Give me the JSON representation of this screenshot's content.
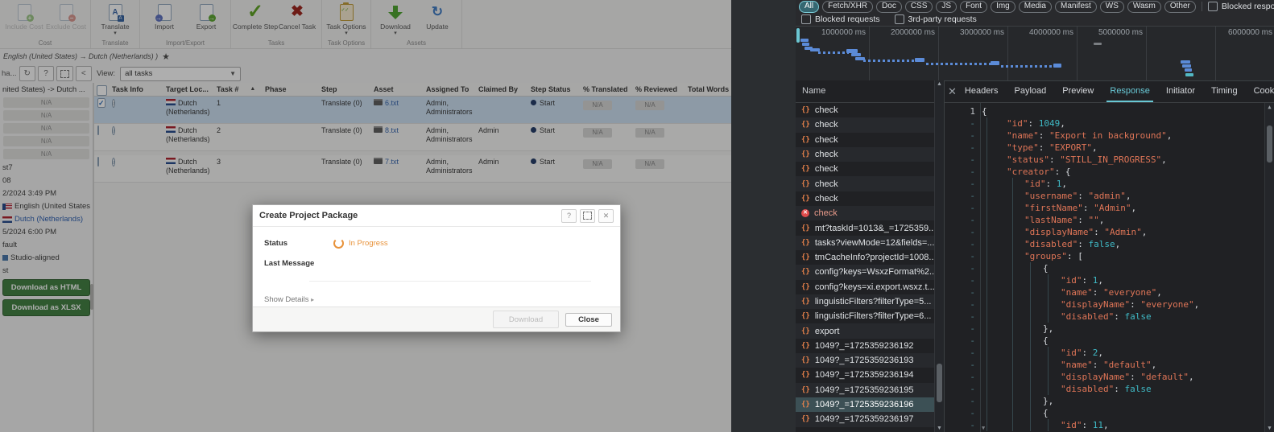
{
  "app": {
    "ribbon_groups": [
      {
        "label": "Cost",
        "buttons": [
          {
            "label": "Include Cost",
            "icon": "doc-plus",
            "disabled": true
          },
          {
            "label": "Exclude Cost",
            "icon": "doc-minus",
            "disabled": true
          }
        ]
      },
      {
        "label": "Translate",
        "buttons": [
          {
            "label": "Translate",
            "icon": "translate",
            "dropdown": true
          }
        ]
      },
      {
        "label": "Import/Export",
        "buttons": [
          {
            "label": "Import",
            "icon": "doc-import"
          },
          {
            "label": "Export",
            "icon": "doc-export"
          }
        ]
      },
      {
        "label": "Tasks",
        "buttons": [
          {
            "label": "Complete Step",
            "icon": "check"
          },
          {
            "label": "Cancel Task",
            "icon": "cross"
          }
        ]
      },
      {
        "label": "Task Options",
        "buttons": [
          {
            "label": "Task Options",
            "icon": "clipboard",
            "dropdown": true
          }
        ]
      },
      {
        "label": "Assets",
        "buttons": [
          {
            "label": "Download",
            "icon": "arrow-down",
            "dropdown": true
          },
          {
            "label": "Update",
            "icon": "refresh"
          }
        ]
      }
    ],
    "breadcrumb": "English (United States) → Dutch (Netherlands) )",
    "subheader": {
      "header_text": "ha...",
      "buttons": [
        "refresh",
        "help",
        "expand",
        "collapse"
      ]
    },
    "view": {
      "label": "View:",
      "value": "all tasks"
    },
    "sidebar": {
      "title": "nited States) -> Dutch ...",
      "na_rows": [
        "N/A",
        "N/A",
        "N/A",
        "N/A",
        "N/A"
      ],
      "lines": [
        {
          "text": "st7"
        },
        {
          "text": "08"
        },
        {
          "text": "2/2024 3:49 PM"
        },
        {
          "text": "English (United States)",
          "flag": "us"
        },
        {
          "text": "Dutch (Netherlands)",
          "flag": "nl",
          "link": true
        },
        {
          "text": "5/2024 6:00 PM"
        },
        {
          "text": "fault"
        },
        {
          "text": "Studio-aligned",
          "marker": true
        },
        {
          "text": "st"
        }
      ],
      "download_html": "Download as HTML",
      "download_xlsx": "Download as XLSX"
    },
    "table": {
      "headers": [
        "",
        "Task Info",
        "Target Loc...",
        "Task #",
        "Phase",
        "Step",
        "Asset",
        "Assigned To",
        "Claimed By",
        "Step Status",
        "% Translated",
        "% Reviewed",
        "Total Words"
      ],
      "sort_column": "Task #",
      "rows": [
        {
          "selected": true,
          "checked": true,
          "target1": "Dutch",
          "target2": "(Netherlands)",
          "task_no": "1",
          "phase": "",
          "step": "Translate (0)",
          "asset": "6.txt",
          "assigned1": "Admin,",
          "assigned2": "Administrators",
          "claimed": "",
          "status": "Start",
          "pct_translated": "N/A",
          "pct_reviewed": "N/A",
          "total_words": ""
        },
        {
          "selected": false,
          "checked": false,
          "target1": "Dutch",
          "target2": "(Netherlands)",
          "task_no": "2",
          "phase": "",
          "step": "Translate (0)",
          "asset": "8.txt",
          "assigned1": "Admin,",
          "assigned2": "Administrators",
          "claimed": "Admin",
          "status": "Start",
          "pct_translated": "N/A",
          "pct_reviewed": "N/A",
          "total_words": ""
        },
        {
          "selected": false,
          "checked": false,
          "target1": "Dutch",
          "target2": "(Netherlands)",
          "task_no": "3",
          "phase": "",
          "step": "Translate (0)",
          "asset": "7.txt",
          "assigned1": "Admin,",
          "assigned2": "Administrators",
          "claimed": "Admin",
          "status": "Start",
          "pct_translated": "N/A",
          "pct_reviewed": "N/A",
          "total_words": ""
        }
      ]
    },
    "modal": {
      "title": "Create Project Package",
      "help_label": "?",
      "close_x_label": "✕",
      "status_label": "Status",
      "status_value": "In Progress",
      "last_message_label": "Last Message",
      "show_details": "Show Details",
      "details_caret": "▸",
      "download_label": "Download",
      "close_label": "Close"
    }
  },
  "devtools": {
    "filters": {
      "pills": [
        "All",
        "Fetch/XHR",
        "Doc",
        "CSS",
        "JS",
        "Font",
        "Img",
        "Media",
        "Manifest",
        "WS",
        "Wasm",
        "Other"
      ],
      "active": "All",
      "blocked_response_cookies": "Blocked response cookies",
      "blocked_requests": "Blocked requests",
      "third_party_requests": "3rd-party requests"
    },
    "timeline": {
      "ticks": [
        "1000000 ms",
        "2000000 ms",
        "3000000 ms",
        "4000000 ms",
        "5000000 ms",
        "6000000 ms"
      ],
      "tick_x": [
        91,
        177,
        263,
        349,
        435,
        521
      ],
      "bars": [
        [
          6,
          15,
          10,
          4
        ],
        [
          8,
          20,
          9,
          4
        ],
        [
          11,
          25,
          10,
          4
        ],
        [
          18,
          27,
          12,
          4
        ],
        [
          63,
          28,
          14,
          5
        ],
        [
          69,
          33,
          12,
          4
        ],
        [
          74,
          38,
          12,
          4
        ],
        [
          148,
          39,
          12,
          5
        ],
        [
          242,
          43,
          11,
          5
        ],
        [
          320,
          46,
          10,
          5
        ],
        [
          478,
          42,
          12,
          4
        ],
        [
          480,
          47,
          11,
          4
        ],
        [
          483,
          52,
          9,
          4
        ]
      ],
      "dots": [
        [
          28,
          31,
          38
        ],
        [
          84,
          41,
          66
        ],
        [
          162,
          45,
          82
        ],
        [
          255,
          48,
          68
        ]
      ],
      "gray_dash": [
        370,
        20,
        10,
        3
      ],
      "teal_mark": [
        484,
        58,
        10,
        4
      ]
    },
    "name_header": "Name",
    "requests": [
      {
        "name": "check",
        "icon": "json"
      },
      {
        "name": "check",
        "icon": "json"
      },
      {
        "name": "check",
        "icon": "json"
      },
      {
        "name": "check",
        "icon": "json"
      },
      {
        "name": "check",
        "icon": "json"
      },
      {
        "name": "check",
        "icon": "json"
      },
      {
        "name": "check",
        "icon": "json"
      },
      {
        "name": "check",
        "icon": "error"
      },
      {
        "name": "mt?taskId=1013&_=1725359...",
        "icon": "json"
      },
      {
        "name": "tasks?viewMode=12&fields=...",
        "icon": "json"
      },
      {
        "name": "tmCacheInfo?projectId=1008...",
        "icon": "json"
      },
      {
        "name": "config?keys=WsxzFormat%2...",
        "icon": "json"
      },
      {
        "name": "config?keys=xi.export.wsxz.t...",
        "icon": "json"
      },
      {
        "name": "linguisticFilters?filterType=5...",
        "icon": "json"
      },
      {
        "name": "linguisticFilters?filterType=6...",
        "icon": "json"
      },
      {
        "name": "export",
        "icon": "json"
      },
      {
        "name": "1049?_=1725359236192",
        "icon": "json"
      },
      {
        "name": "1049?_=1725359236193",
        "icon": "json"
      },
      {
        "name": "1049?_=1725359236194",
        "icon": "json"
      },
      {
        "name": "1049?_=1725359236195",
        "icon": "json"
      },
      {
        "name": "1049?_=1725359236196",
        "icon": "json",
        "selected": true
      },
      {
        "name": "1049?_=1725359236197",
        "icon": "json"
      }
    ],
    "tabs": [
      "Headers",
      "Payload",
      "Preview",
      "Response",
      "Initiator",
      "Timing",
      "Cookies"
    ],
    "active_tab": "Response",
    "tab_close_label": "✕",
    "response_lines": [
      {
        "g": "1",
        "i": 0,
        "c": "{"
      },
      {
        "g": "-",
        "i": 1,
        "c": "\"id\": 1049,"
      },
      {
        "g": "-",
        "i": 1,
        "c": "\"name\": \"Export in background\","
      },
      {
        "g": "-",
        "i": 1,
        "c": "\"type\": \"EXPORT\","
      },
      {
        "g": "-",
        "i": 1,
        "c": "\"status\": \"STILL_IN_PROGRESS\","
      },
      {
        "g": "-",
        "i": 1,
        "c": "\"creator\": {"
      },
      {
        "g": "-",
        "i": 2,
        "c": "\"id\": 1,"
      },
      {
        "g": "-",
        "i": 2,
        "c": "\"username\": \"admin\","
      },
      {
        "g": "-",
        "i": 2,
        "c": "\"firstName\": \"Admin\","
      },
      {
        "g": "-",
        "i": 2,
        "c": "\"lastName\": \"\","
      },
      {
        "g": "-",
        "i": 2,
        "c": "\"displayName\": \"Admin\","
      },
      {
        "g": "-",
        "i": 2,
        "c": "\"disabled\": false,"
      },
      {
        "g": "-",
        "i": 2,
        "c": "\"groups\": ["
      },
      {
        "g": "-",
        "i": 3,
        "c": "{"
      },
      {
        "g": "-",
        "i": 4,
        "c": "\"id\": 1,"
      },
      {
        "g": "-",
        "i": 4,
        "c": "\"name\": \"everyone\","
      },
      {
        "g": "-",
        "i": 4,
        "c": "\"displayName\": \"everyone\","
      },
      {
        "g": "-",
        "i": 4,
        "c": "\"disabled\": false"
      },
      {
        "g": "-",
        "i": 3,
        "c": "},"
      },
      {
        "g": "-",
        "i": 3,
        "c": "{"
      },
      {
        "g": "-",
        "i": 4,
        "c": "\"id\": 2,"
      },
      {
        "g": "-",
        "i": 4,
        "c": "\"name\": \"default\","
      },
      {
        "g": "-",
        "i": 4,
        "c": "\"displayName\": \"default\","
      },
      {
        "g": "-",
        "i": 4,
        "c": "\"disabled\": false"
      },
      {
        "g": "-",
        "i": 3,
        "c": "},"
      },
      {
        "g": "-",
        "i": 3,
        "c": "{"
      },
      {
        "g": "-",
        "i": 4,
        "c": "\"id\": 11,"
      }
    ]
  },
  "colors": {
    "waterfall_bar": "#5b8bd8",
    "waterfall_gray": "#7a7e82",
    "waterfall_teal": "#52b9c4",
    "devtools_accent": "#68c7d4",
    "status_orange": "#e8923a",
    "download_green": "#3e7d3e"
  }
}
